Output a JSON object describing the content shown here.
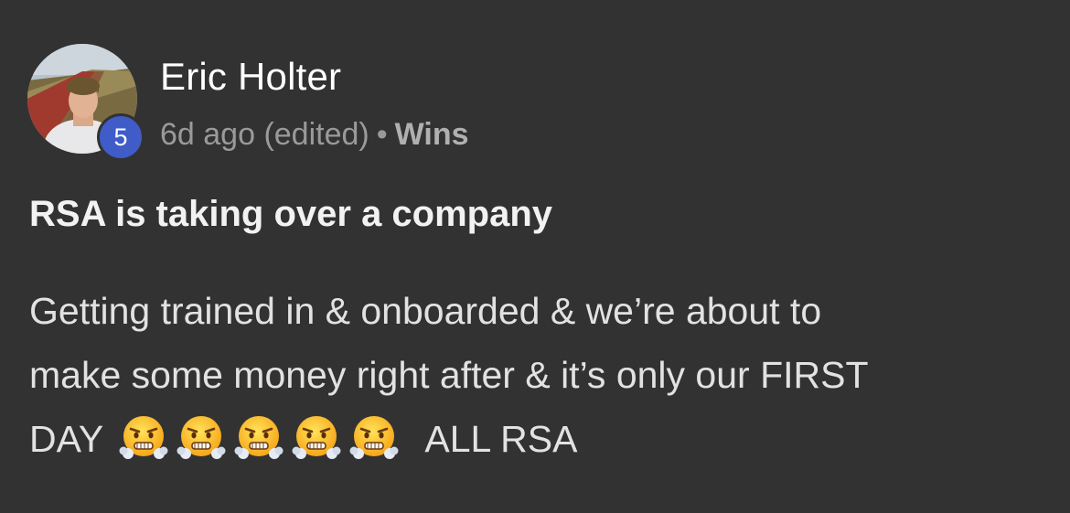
{
  "post": {
    "author": {
      "name": "Eric Holter",
      "level": "5"
    },
    "meta": {
      "timestamp": "6d ago (edited)",
      "separator": "•",
      "category": "Wins"
    },
    "title": "RSA is taking over a company",
    "body": {
      "line1": "Getting trained in & onboarded & we’re about to",
      "line2": "make some money right after & it’s only our FIRST",
      "line3_prefix": "DAY",
      "emoji_name": "face-with-steam-from-nose",
      "emoji_count": 5,
      "line3_suffix": "ALL RSA"
    },
    "colors": {
      "background": "#323232",
      "badge": "#3f5cc8"
    }
  }
}
